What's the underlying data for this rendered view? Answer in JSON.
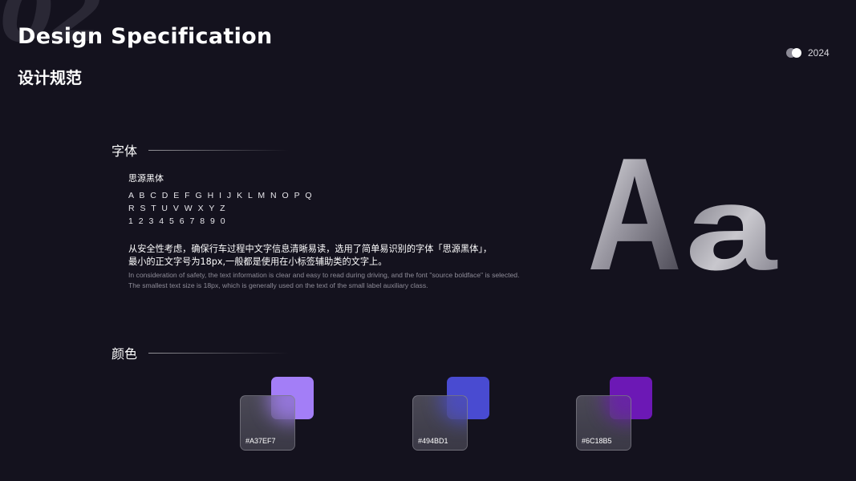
{
  "header": {
    "bg_number": "02",
    "title": "Design Specification",
    "subtitle": "设计规范",
    "year": "2024"
  },
  "font_section": {
    "label": "字体",
    "font_name": "思源黑体",
    "alphabet_line1": "A B C D E F G H I J K L M N O P Q",
    "alphabet_line2": "R S T U V W X Y Z",
    "digits": "1 2 3 4 5 6 7 8 9 0",
    "desc_cn_line1": "从安全性考虑，确保行车过程中文字信息清晰易读，选用了简单易识别的字体「思源黑体」，",
    "desc_cn_line2": "最小的正文字号为18px,一般都是使用在小标签辅助类的文字上。",
    "desc_en_line1": "In consideration of safety, the text information is clear and easy to read during driving, and the font \"source boldface\" is selected.",
    "desc_en_line2": "The smallest text size is 18px, which is generally used on the text of the small label auxiliary class.",
    "sample_glyph": "Aa"
  },
  "color_section": {
    "label": "颜色",
    "swatches": [
      {
        "hex_label": "#A37EF7",
        "color": "#A37EF7"
      },
      {
        "hex_label": "#494BD1",
        "color": "#494BD1"
      },
      {
        "hex_label": "#6C18B5",
        "color": "#6C18B5"
      }
    ]
  }
}
